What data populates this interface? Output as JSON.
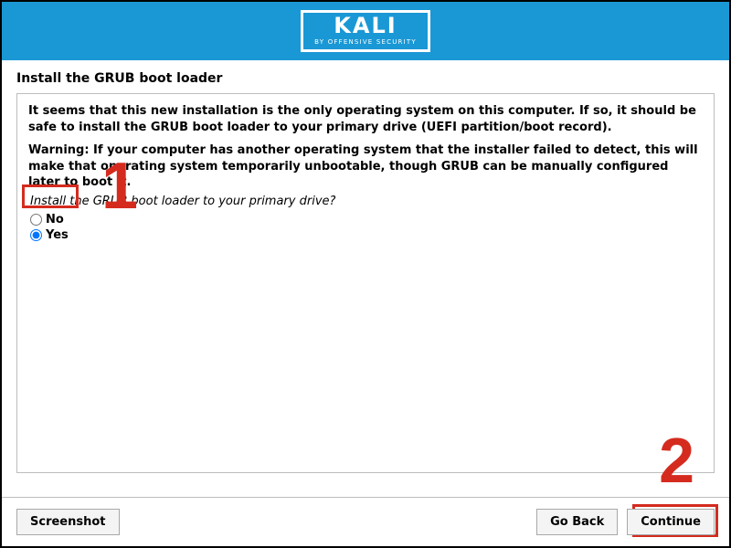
{
  "header": {
    "logo_main": "KALI",
    "logo_sub": "BY OFFENSIVE SECURITY"
  },
  "page": {
    "title": "Install the GRUB boot loader"
  },
  "content": {
    "intro": "It seems that this new installation is the only operating system on this computer. If so, it should be safe to install the GRUB boot loader to your primary drive (UEFI partition/boot record).",
    "warning": "Warning: If your computer has another operating system that the installer failed to detect, this will make that operating system temporarily unbootable, though GRUB can be manually configured later to boot it.",
    "question": "Install the GRUB boot loader to your primary drive?",
    "options": {
      "no": "No",
      "yes": "Yes"
    },
    "selected": "yes"
  },
  "footer": {
    "screenshot": "Screenshot",
    "go_back": "Go Back",
    "continue": "Continue"
  },
  "annotations": {
    "one": "1",
    "two": "2"
  }
}
